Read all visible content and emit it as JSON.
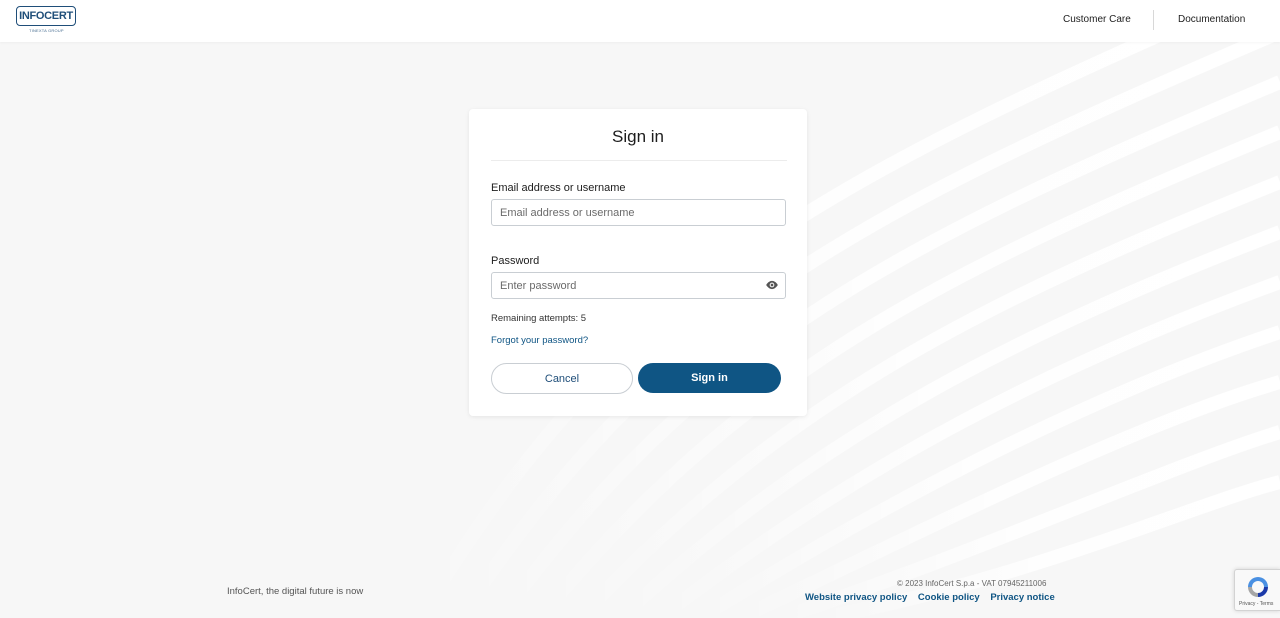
{
  "header": {
    "logo_text": "INFOCERT",
    "logo_subtext": "TINEXTA GROUP",
    "nav": {
      "customer_care": "Customer Care",
      "documentation": "Documentation"
    }
  },
  "signin": {
    "title": "Sign in",
    "email_label": "Email address or username",
    "email_placeholder": "Email address or username",
    "email_value": "",
    "password_label": "Password",
    "password_placeholder": "Enter password",
    "password_value": "",
    "show_password_icon": "eye-icon",
    "remaining_attempts": "Remaining attempts: 5",
    "forgot_password": "Forgot your password?",
    "cancel_label": "Cancel",
    "submit_label": "Sign in"
  },
  "footer": {
    "tagline": "InfoCert, the digital future is now",
    "copyright": "© 2023 InfoCert S.p.a - VAT 07945211006",
    "links": {
      "website_privacy": "Website privacy policy",
      "cookie_policy": "Cookie policy",
      "privacy_notice": "Privacy notice"
    }
  },
  "recaptcha": {
    "text": "Privacy - Terms"
  },
  "colors": {
    "brand": "#1f4e79",
    "primary_button": "#0f5584",
    "link": "#0f5584",
    "background": "#f7f7f7"
  }
}
